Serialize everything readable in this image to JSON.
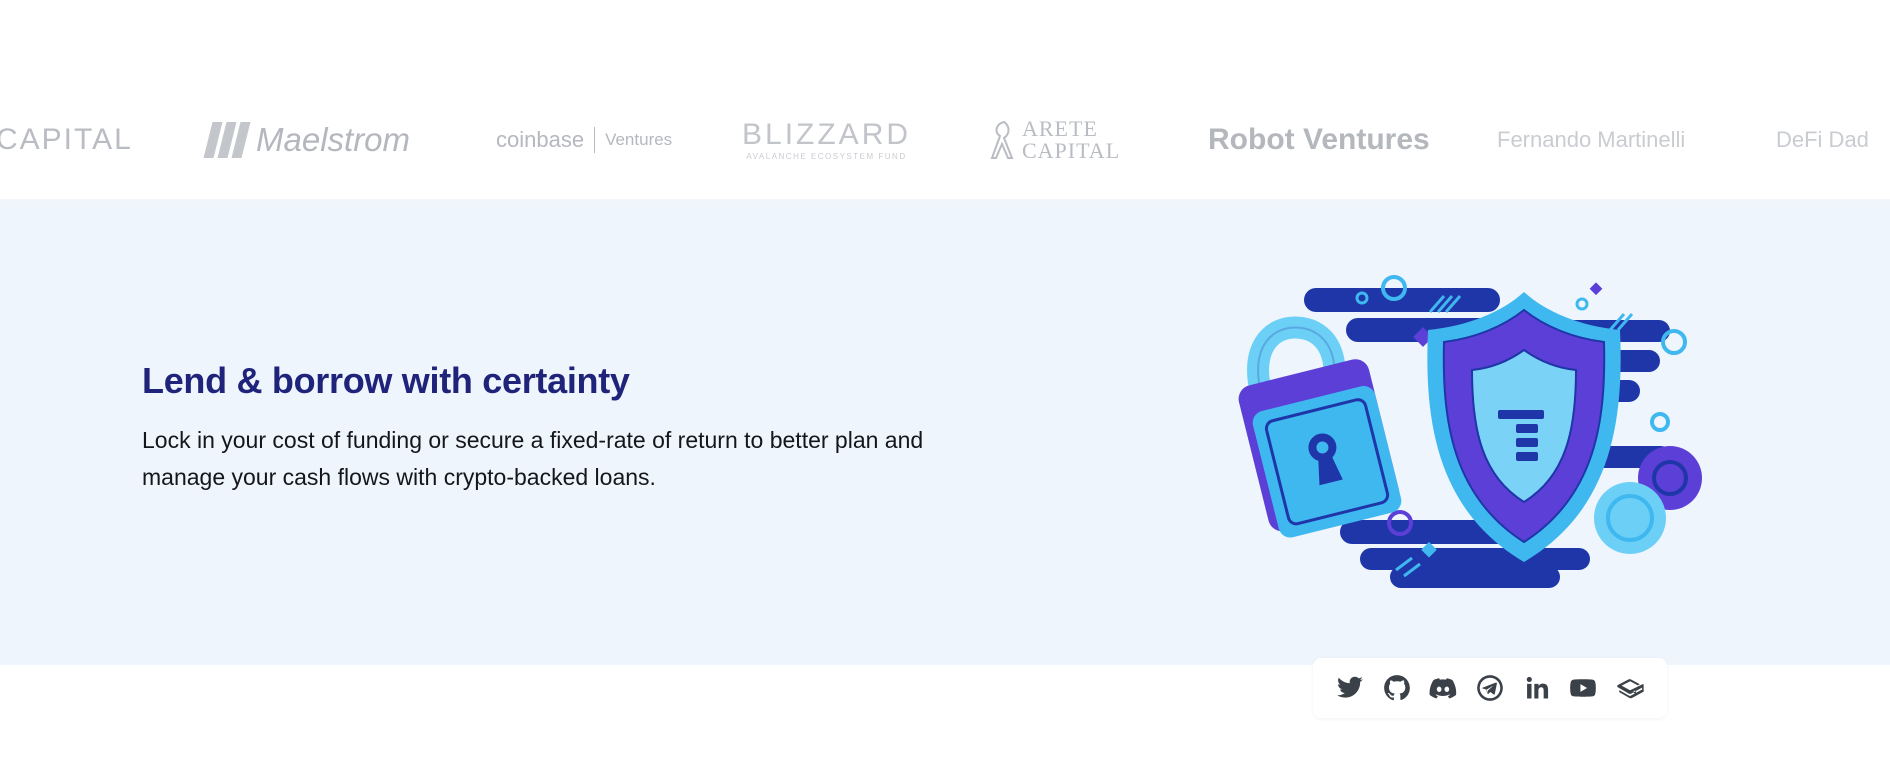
{
  "partners": {
    "capital": "CAPITAL",
    "maelstrom": "Maelstrom",
    "coinbase": "coinbase",
    "coinbase_sub": "Ventures",
    "blizzard": "BLIZZARD",
    "blizzard_sub": "AVALANCHE ECOSYSTEM FUND",
    "arete_line1": "ARETE",
    "arete_line2": "CAPITAL",
    "robot": "Robot Ventures",
    "fernando": "Fernando Martinelli",
    "defi": "DeFi Dad"
  },
  "hero": {
    "title": "Lend & borrow with certainty",
    "text": "Lock in your cost of funding or secure a fixed-rate of return to better plan and manage your cash flows with crypto-backed loans."
  },
  "social": {
    "icons": [
      "twitter-icon",
      "github-icon",
      "discord-icon",
      "telegram-icon",
      "linkedin-icon",
      "youtube-icon",
      "gitbook-icon"
    ]
  },
  "colors": {
    "band": "#eef5fd",
    "title": "#1f237a",
    "navy": "#1f36a8",
    "purple": "#5b3fd6",
    "sky": "#3fb8f0",
    "light": "#7ad3f7"
  }
}
